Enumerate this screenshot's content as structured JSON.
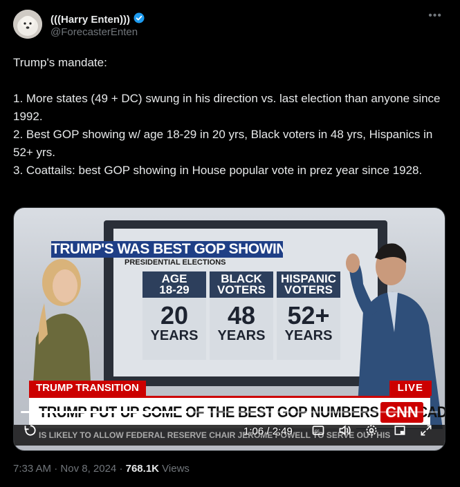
{
  "author": {
    "display_name": "(((Harry Enten)))",
    "handle": "@ForecasterEnten",
    "verified": true
  },
  "menu_icon": "more-icon",
  "tweet_text": "Trump's mandate:\n\n1. More states (49 + DC) swung in his direction vs. last election than anyone since 1992.\n2. Best GOP showing w/ age 18-29 in 20 yrs, Black voters in 48 yrs, Hispanics in 52+ yrs.\n3. Coattails: best GOP showing in House popular vote in prez year since 1928.",
  "video": {
    "graphic_title": "TRUMP'S WAS BEST GOP SHOWING IN",
    "graphic_subtitle": "PRESIDENTIAL ELECTIONS",
    "columns": [
      {
        "head": "AGE\n18-29",
        "num": "20",
        "unit": "YEARS"
      },
      {
        "head": "BLACK\nVOTERS",
        "num": "48",
        "unit": "YEARS"
      },
      {
        "head": "HISPANIC\nVOTERS",
        "num": "52+",
        "unit": "YEARS"
      }
    ],
    "section_tag": "TRUMP TRANSITION",
    "live_tag": "LIVE",
    "headline": "TRUMP PUT UP SOME OF THE BEST GOP NUMBERS IN DECADES",
    "network_logo": "CNN",
    "ticker": "IS LIKELY TO ALLOW FEDERAL RESERVE CHAIR JEROME POWELL TO SERVE OUT HIS",
    "time_display": "1:06 / 2:49",
    "progress": 0.4,
    "accent_color": "#cc0000"
  },
  "footer": {
    "time": "7:33 AM",
    "date": "Nov 8, 2024",
    "views_count": "768.1K",
    "views_label": "Views"
  }
}
